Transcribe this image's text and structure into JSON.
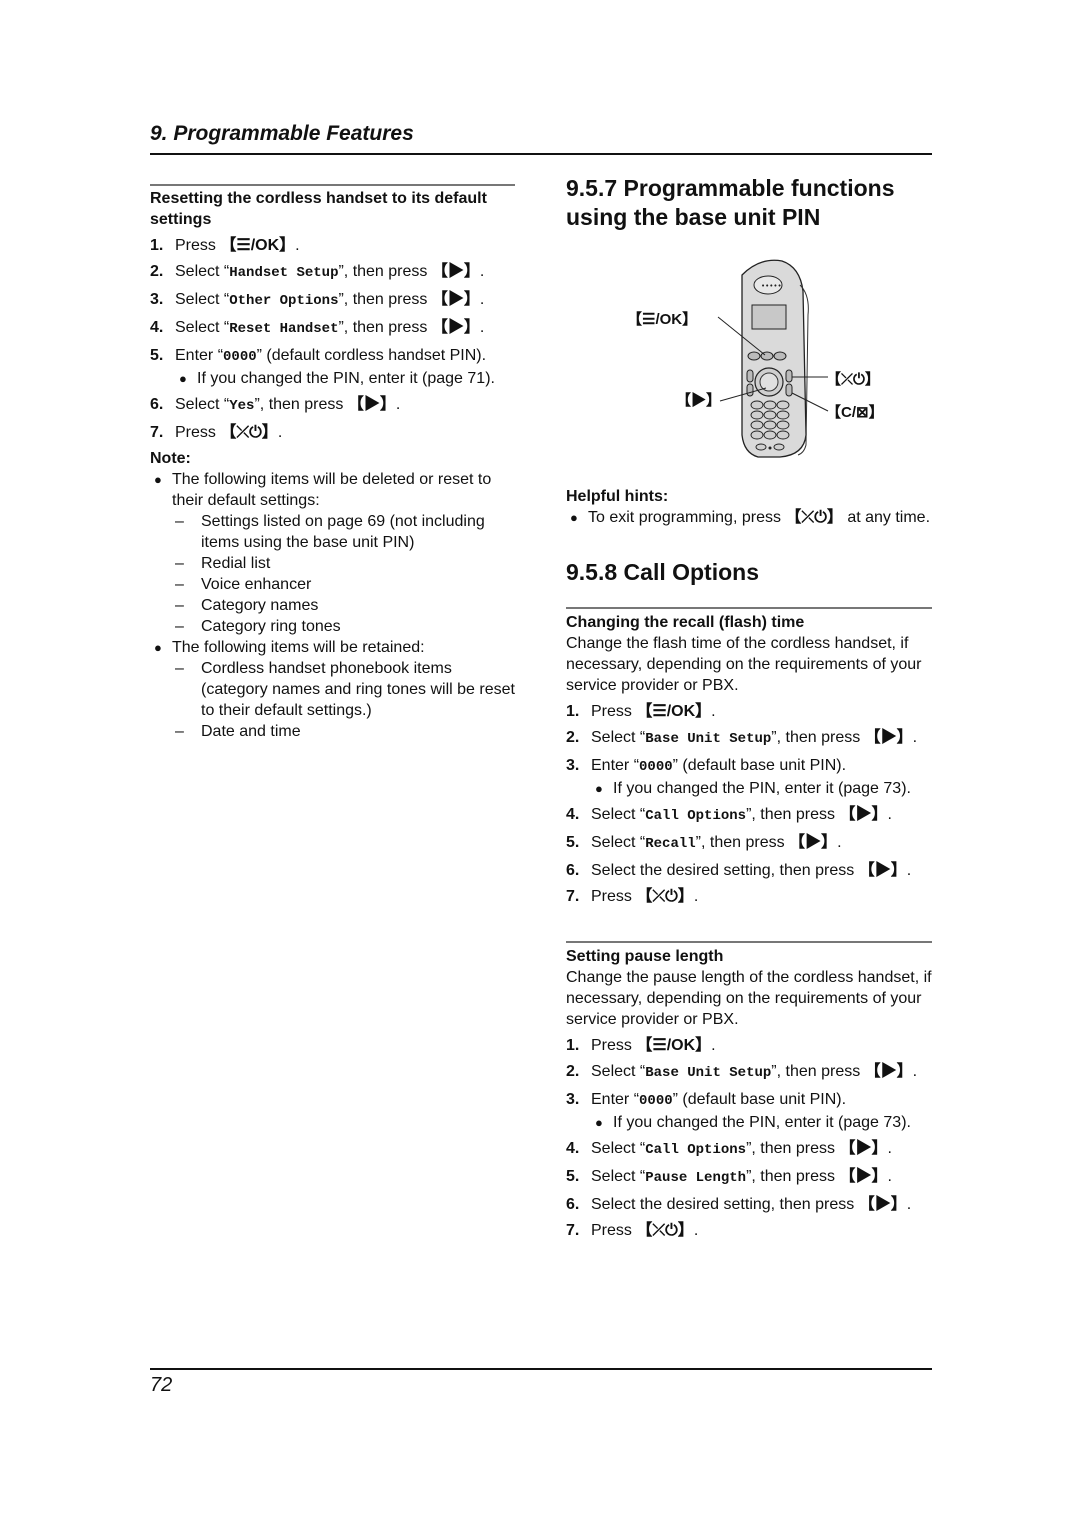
{
  "header": {
    "chapter_title": "9. Programmable Features"
  },
  "left": {
    "section_title": "Resetting the cordless handset to its default settings",
    "steps": [
      {
        "num": "1.",
        "pre": "Press ",
        "key": "【☰/OK】",
        "post": "."
      },
      {
        "num": "2.",
        "pre": "Select “",
        "mono": "Handset Setup",
        "mid": "”, then press ",
        "key": "【▶】",
        "post": "."
      },
      {
        "num": "3.",
        "pre": "Select “",
        "mono": "Other Options",
        "mid": "”, then press ",
        "key": "【▶】",
        "post": "."
      },
      {
        "num": "4.",
        "pre": "Select “",
        "mono": "Reset Handset",
        "mid": "”, then press ",
        "key": "【▶】",
        "post": "."
      },
      {
        "num": "5.",
        "pre": "Enter “",
        "mono": "0000",
        "mid": "” (default cordless handset PIN).",
        "bullet": "If you changed the PIN, enter it (page 71)."
      },
      {
        "num": "6.",
        "pre": "Select “",
        "mono": "Yes",
        "mid": "”, then press ",
        "key": "【▶】",
        "post": "."
      },
      {
        "num": "7.",
        "pre": "Press ",
        "key": "【⤫⏻】",
        "post": "."
      }
    ],
    "note_label": "Note:",
    "note_bullets": [
      {
        "text": "The following items will be deleted or reset to their default settings:",
        "items": [
          "Settings listed on page 69 (not including items using the base unit PIN)",
          "Redial list",
          "Voice enhancer",
          "Category names",
          "Category ring tones"
        ]
      },
      {
        "text": "The following items will be retained:",
        "items": [
          "Cordless handset phonebook items (category names and ring tones will be reset to their default settings.)",
          "Date and time"
        ]
      }
    ]
  },
  "right": {
    "section_957_title": "9.5.7 Programmable functions using the base unit PIN",
    "figure_labels": {
      "menu_ok": "【☰/OK】",
      "navigator_right": "【▶】",
      "off": "【⤫⏻】",
      "clear": "【C/⊠】"
    },
    "hints_label": "Helpful hints:",
    "hint_pre": "To exit programming, press ",
    "hint_key": "【⤫⏻】",
    "hint_post": " at any time.",
    "section_958_title": "9.5.8 Call Options",
    "recall": {
      "title": "Changing the recall (flash) time",
      "desc": "Change the flash time of the cordless handset, if necessary, depending on the requirements of your service provider or PBX.",
      "steps": [
        {
          "num": "1.",
          "pre": "Press ",
          "key": "【☰/OK】",
          "post": "."
        },
        {
          "num": "2.",
          "pre": "Select “",
          "mono": "Base Unit Setup",
          "mid": "”, then press ",
          "key": "【▶】",
          "post": "."
        },
        {
          "num": "3.",
          "pre": "Enter “",
          "mono": "0000",
          "mid": "” (default base unit PIN).",
          "bullet": "If you changed the PIN, enter it (page 73)."
        },
        {
          "num": "4.",
          "pre": "Select “",
          "mono": "Call Options",
          "mid": "”, then press ",
          "key": "【▶】",
          "post": "."
        },
        {
          "num": "5.",
          "pre": "Select “",
          "mono": "Recall",
          "mid": "”, then press ",
          "key": "【▶】",
          "post": "."
        },
        {
          "num": "6.",
          "pre": "Select the desired setting, then press ",
          "key": "【▶】",
          "post": "."
        },
        {
          "num": "7.",
          "pre": "Press ",
          "key": "【⤫⏻】",
          "post": "."
        }
      ]
    },
    "pause": {
      "title": "Setting pause length",
      "desc": "Change the pause length of the cordless handset, if necessary, depending on the requirements of your service provider or PBX.",
      "steps": [
        {
          "num": "1.",
          "pre": "Press ",
          "key": "【☰/OK】",
          "post": "."
        },
        {
          "num": "2.",
          "pre": "Select “",
          "mono": "Base Unit Setup",
          "mid": "”, then press ",
          "key": "【▶】",
          "post": "."
        },
        {
          "num": "3.",
          "pre": "Enter “",
          "mono": "0000",
          "mid": "” (default base unit PIN).",
          "bullet": "If you changed the PIN, enter it (page 73)."
        },
        {
          "num": "4.",
          "pre": "Select “",
          "mono": "Call Options",
          "mid": "”, then press ",
          "key": "【▶】",
          "post": "."
        },
        {
          "num": "5.",
          "pre": "Select “",
          "mono": "Pause Length",
          "mid": "”, then press ",
          "key": "【▶】",
          "post": "."
        },
        {
          "num": "6.",
          "pre": "Select the desired setting, then press ",
          "key": "【▶】",
          "post": "."
        },
        {
          "num": "7.",
          "pre": "Press ",
          "key": "【⤫⏻】",
          "post": "."
        }
      ]
    }
  },
  "footer": {
    "page_number": "72"
  }
}
